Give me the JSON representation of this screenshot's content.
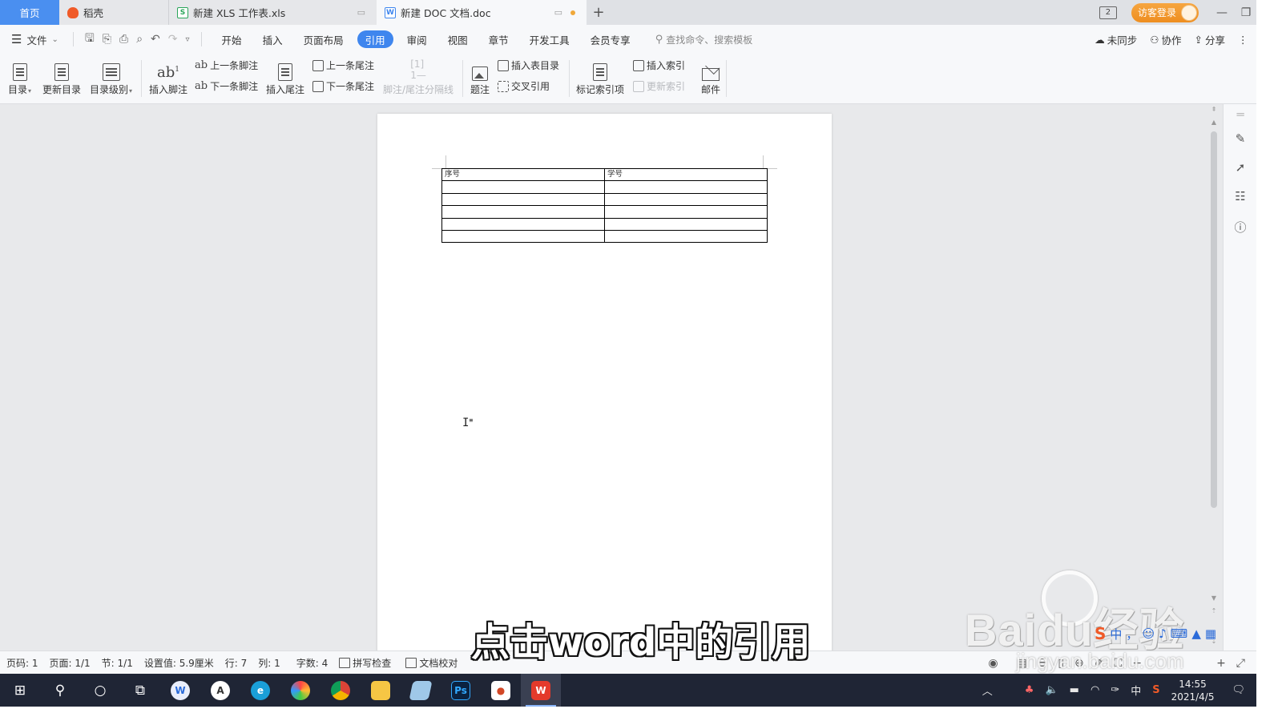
{
  "tabs": {
    "home": "首页",
    "daoke": "稻壳",
    "xls": "新建 XLS 工作表.xls",
    "doc": "新建 DOC 文档.doc",
    "add": "+"
  },
  "titlebar": {
    "badge": "2",
    "visitor_login": "访客登录"
  },
  "menubar": {
    "file": "文件",
    "tabs": [
      "开始",
      "插入",
      "页面布局",
      "引用",
      "审阅",
      "视图",
      "章节",
      "开发工具",
      "会员专享"
    ],
    "active_tab": "引用",
    "search": "查找命令、搜索模板",
    "unsynced": "未同步",
    "collab": "协作",
    "share": "分享"
  },
  "ribbon": {
    "toc": "目录",
    "update_toc": "更新目录",
    "toc_level": "目录级别",
    "insert_footnote": "插入脚注",
    "prev_footnote": "上一条脚注",
    "next_footnote": "下一条脚注",
    "insert_endnote": "插入尾注",
    "prev_endnote": "上一条尾注",
    "next_endnote": "下一条尾注",
    "separator": "脚注/尾注分隔线",
    "caption": "题注",
    "insert_table_toc": "插入表目录",
    "cross_ref": "交叉引用",
    "mark_index": "标记索引项",
    "insert_index": "插入索引",
    "update_index": "更新索引",
    "mail": "邮件"
  },
  "document": {
    "table": {
      "headers": [
        "序号",
        "学号"
      ],
      "rows": [
        [
          "",
          ""
        ],
        [
          "",
          ""
        ],
        [
          "",
          ""
        ],
        [
          "",
          ""
        ],
        [
          "",
          ""
        ]
      ]
    }
  },
  "statusbar": {
    "page_num": "页码: 1",
    "pages": "页面: 1/1",
    "section": "节: 1/1",
    "setting": "设置值: 5.9厘米",
    "row": "行: 7",
    "col": "列: 1",
    "word_count": "字数: 4",
    "spell_check": "拼写检查",
    "doc_check": "文档校对"
  },
  "taskbar": {
    "time": "14:55",
    "date": "2021/4/5",
    "ime": "中"
  },
  "overlay": {
    "subtitle": "点击word中的引用",
    "watermark_main": "Baidu经验",
    "watermark_sub": "jingyan.baidu.com"
  },
  "colors": {
    "accent": "#3f86ee",
    "home_tab": "#4a8ff0",
    "visitor": "#f09830",
    "taskbar": "#1f2535"
  }
}
